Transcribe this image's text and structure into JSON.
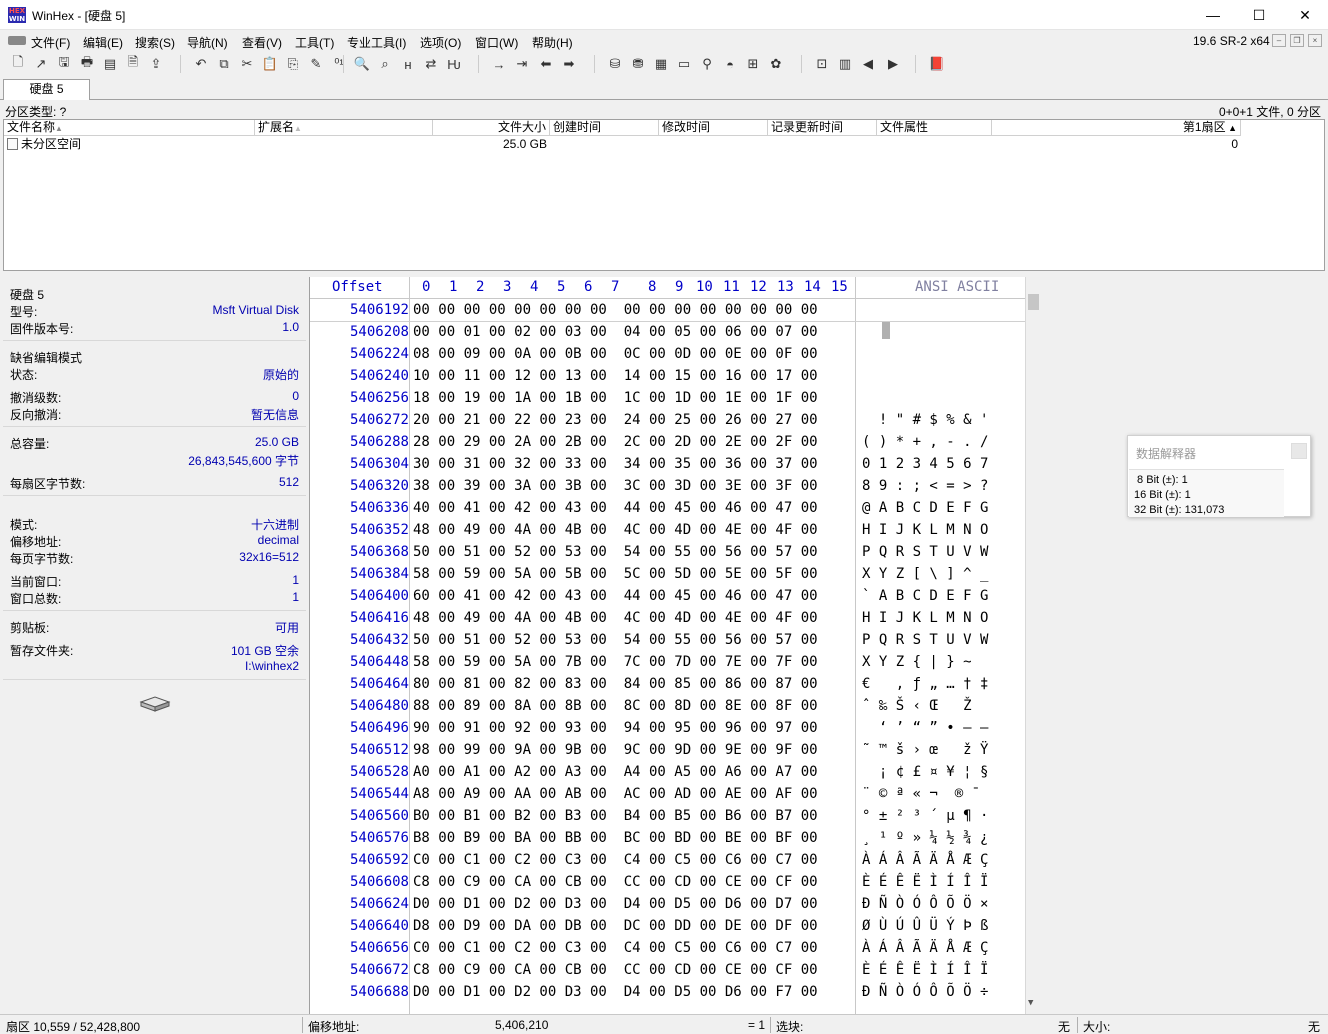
{
  "window": {
    "title": "WinHex - [硬盘 5]",
    "logo_line1": "HEX",
    "logo_line2": "WIN",
    "minimize_glyph": "—",
    "maximize_glyph": "☐",
    "close_glyph": "✕"
  },
  "menu": {
    "items": [
      "文件(F)",
      "编辑(E)",
      "搜索(S)",
      "导航(N)",
      "查看(V)",
      "工具(T)",
      "专业工具(I)",
      "选项(O)",
      "窗口(W)",
      "帮助(H)"
    ],
    "version": "19.6 SR-2 x64"
  },
  "toolbar": {
    "icons": [
      "new-file-icon",
      "open-icon",
      "save-icon",
      "print-icon",
      "properties-icon",
      "document-icon",
      "export-icon",
      "undo-icon",
      "copy-icon",
      "cut-icon",
      "paste-icon",
      "paste-special-icon",
      "write-icon",
      "binary-icon",
      "find-icon",
      "find-next-icon",
      "find-hex-icon",
      "replace-icon",
      "replace-hex-icon",
      "goto-offset-icon",
      "goto-sector-icon",
      "back-icon",
      "forward-icon",
      "disk-open-icon",
      "disk-clone-icon",
      "ram-icon",
      "calculator-icon",
      "search-disk-icon",
      "image-icon",
      "hash-icon",
      "settings-icon",
      "grid-icon",
      "table-icon",
      "prev-icon",
      "next-icon",
      "book-icon"
    ],
    "glyphs": [
      "🗋",
      "↗",
      "🖫",
      "🖶",
      "▤",
      "🗎",
      "⇪",
      "↶",
      "⧉",
      "✂",
      "📋",
      "⎘",
      "✎",
      "⁰¹",
      "🔍",
      "⌕",
      "ʜ",
      "⇄",
      "Ƕ",
      "→",
      "⇥",
      "⬅",
      "➡",
      "⛁",
      "⛃",
      "▦",
      "▭",
      "⚲",
      "◓",
      "⊞",
      "✿",
      "⊡",
      "▥",
      "◀",
      "▶",
      "📕"
    ]
  },
  "tab": {
    "label": "硬盘 5"
  },
  "partition": {
    "type_label": "分区类型: ?",
    "summary": "0+0+1 文件, 0 分区"
  },
  "file_list": {
    "columns": [
      "文件名称",
      "扩展名",
      "文件大小",
      "创建时间",
      "修改时间",
      "记录更新时间",
      "文件属性",
      "第1扇区"
    ],
    "rows": [
      {
        "name": "未分区空间",
        "ext": "",
        "size": "25.0 GB",
        "created": "",
        "modified": "",
        "record_changed": "",
        "attributes": "",
        "first_sector": "0"
      }
    ]
  },
  "info_panel": {
    "disk_name": "硬盘 5",
    "model_label": "型号:",
    "model_value": "Msft Virtual Disk",
    "firmware_label": "固件版本号:",
    "firmware_value": "1.0",
    "edit_mode_label": "缺省编辑模式",
    "state_label": "状态:",
    "state_value": "原始的",
    "undo_levels_label": "撤消级数:",
    "undo_levels_value": "0",
    "reverse_undo_label": "反向撤消:",
    "reverse_undo_value": "暂无信息",
    "capacity_label": "总容量:",
    "capacity_value": "25.0 GB",
    "capacity_bytes": "26,843,545,600 字节",
    "bytes_per_sector_label": "每扇区字节数:",
    "bytes_per_sector_value": "512",
    "mode_label": "模式:",
    "mode_value": "十六进制",
    "offset_label": "偏移地址:",
    "offset_value": "decimal",
    "bytes_per_page_label": "每页字节数:",
    "bytes_per_page_value": "32x16=512",
    "current_window_label": "当前窗口:",
    "current_window_value": "1",
    "total_windows_label": "窗口总数:",
    "total_windows_value": "1",
    "clipboard_label": "剪贴板:",
    "clipboard_value": "可用",
    "temp_folder_label": "暂存文件夹:",
    "temp_folder_free": "101 GB 空余",
    "temp_folder_path": "I:\\winhex2"
  },
  "hex_view": {
    "offset_header": "Offset",
    "column_headers": [
      "0",
      "1",
      "2",
      "3",
      "4",
      "5",
      "6",
      "7",
      "8",
      "9",
      "10",
      "11",
      "12",
      "13",
      "14",
      "15"
    ],
    "ansi_header": "ANSI ASCII",
    "rows": [
      {
        "offset": "5406192",
        "bytes": "00 00 00 00 00 00 00 00  00 00 00 00 00 00 00 00",
        "ansi": ""
      },
      {
        "offset": "5406208",
        "bytes": "00 00 01 00 02 00 03 00  04 00 05 00 06 00 07 00",
        "ansi": ""
      },
      {
        "offset": "5406224",
        "bytes": "08 00 09 00 0A 00 0B 00  0C 00 0D 00 0E 00 0F 00",
        "ansi": ""
      },
      {
        "offset": "5406240",
        "bytes": "10 00 11 00 12 00 13 00  14 00 15 00 16 00 17 00",
        "ansi": ""
      },
      {
        "offset": "5406256",
        "bytes": "18 00 19 00 1A 00 1B 00  1C 00 1D 00 1E 00 1F 00",
        "ansi": ""
      },
      {
        "offset": "5406272",
        "bytes": "20 00 21 00 22 00 23 00  24 00 25 00 26 00 27 00",
        "ansi": "  ! \" # $ % & '"
      },
      {
        "offset": "5406288",
        "bytes": "28 00 29 00 2A 00 2B 00  2C 00 2D 00 2E 00 2F 00",
        "ansi": "( ) * + , - . /"
      },
      {
        "offset": "5406304",
        "bytes": "30 00 31 00 32 00 33 00  34 00 35 00 36 00 37 00",
        "ansi": "0 1 2 3 4 5 6 7"
      },
      {
        "offset": "5406320",
        "bytes": "38 00 39 00 3A 00 3B 00  3C 00 3D 00 3E 00 3F 00",
        "ansi": "8 9 : ; < = > ?"
      },
      {
        "offset": "5406336",
        "bytes": "40 00 41 00 42 00 43 00  44 00 45 00 46 00 47 00",
        "ansi": "@ A B C D E F G"
      },
      {
        "offset": "5406352",
        "bytes": "48 00 49 00 4A 00 4B 00  4C 00 4D 00 4E 00 4F 00",
        "ansi": "H I J K L M N O"
      },
      {
        "offset": "5406368",
        "bytes": "50 00 51 00 52 00 53 00  54 00 55 00 56 00 57 00",
        "ansi": "P Q R S T U V W"
      },
      {
        "offset": "5406384",
        "bytes": "58 00 59 00 5A 00 5B 00  5C 00 5D 00 5E 00 5F 00",
        "ansi": "X Y Z [ \\ ] ^ _"
      },
      {
        "offset": "5406400",
        "bytes": "60 00 41 00 42 00 43 00  44 00 45 00 46 00 47 00",
        "ansi": "` A B C D E F G"
      },
      {
        "offset": "5406416",
        "bytes": "48 00 49 00 4A 00 4B 00  4C 00 4D 00 4E 00 4F 00",
        "ansi": "H I J K L M N O"
      },
      {
        "offset": "5406432",
        "bytes": "50 00 51 00 52 00 53 00  54 00 55 00 56 00 57 00",
        "ansi": "P Q R S T U V W"
      },
      {
        "offset": "5406448",
        "bytes": "58 00 59 00 5A 00 7B 00  7C 00 7D 00 7E 00 7F 00",
        "ansi": "X Y Z { | } ~"
      },
      {
        "offset": "5406464",
        "bytes": "80 00 81 00 82 00 83 00  84 00 85 00 86 00 87 00",
        "ansi": "€   ‚ ƒ „ … † ‡"
      },
      {
        "offset": "5406480",
        "bytes": "88 00 89 00 8A 00 8B 00  8C 00 8D 00 8E 00 8F 00",
        "ansi": "ˆ ‰ Š ‹ Œ   Ž"
      },
      {
        "offset": "5406496",
        "bytes": "90 00 91 00 92 00 93 00  94 00 95 00 96 00 97 00",
        "ansi": "  ‘ ’ “ ” • – —"
      },
      {
        "offset": "5406512",
        "bytes": "98 00 99 00 9A 00 9B 00  9C 00 9D 00 9E 00 9F 00",
        "ansi": "˜ ™ š › œ   ž Ÿ"
      },
      {
        "offset": "5406528",
        "bytes": "A0 00 A1 00 A2 00 A3 00  A4 00 A5 00 A6 00 A7 00",
        "ansi": "  ¡ ¢ £ ¤ ¥ ¦ §"
      },
      {
        "offset": "5406544",
        "bytes": "A8 00 A9 00 AA 00 AB 00  AC 00 AD 00 AE 00 AF 00",
        "ansi": "¨ © ª « ¬ ­ ® ¯"
      },
      {
        "offset": "5406560",
        "bytes": "B0 00 B1 00 B2 00 B3 00  B4 00 B5 00 B6 00 B7 00",
        "ansi": "° ± ² ³ ´ µ ¶ ·"
      },
      {
        "offset": "5406576",
        "bytes": "B8 00 B9 00 BA 00 BB 00  BC 00 BD 00 BE 00 BF 00",
        "ansi": "¸ ¹ º » ¼ ½ ¾ ¿"
      },
      {
        "offset": "5406592",
        "bytes": "C0 00 C1 00 C2 00 C3 00  C4 00 C5 00 C6 00 C7 00",
        "ansi": "À Á Â Ã Ä Å Æ Ç"
      },
      {
        "offset": "5406608",
        "bytes": "C8 00 C9 00 CA 00 CB 00  CC 00 CD 00 CE 00 CF 00",
        "ansi": "È É Ê Ë Ì Í Î Ï"
      },
      {
        "offset": "5406624",
        "bytes": "D0 00 D1 00 D2 00 D3 00  D4 00 D5 00 D6 00 D7 00",
        "ansi": "Ð Ñ Ò Ó Ô Õ Ö ×"
      },
      {
        "offset": "5406640",
        "bytes": "D8 00 D9 00 DA 00 DB 00  DC 00 DD 00 DE 00 DF 00",
        "ansi": "Ø Ù Ú Û Ü Ý Þ ß"
      },
      {
        "offset": "5406656",
        "bytes": "C0 00 C1 00 C2 00 C3 00  C4 00 C5 00 C6 00 C7 00",
        "ansi": "À Á Â Ã Ä Å Æ Ç"
      },
      {
        "offset": "5406672",
        "bytes": "C8 00 C9 00 CA 00 CB 00  CC 00 CD 00 CE 00 CF 00",
        "ansi": "È É Ê Ë Ì Í Î Ï"
      },
      {
        "offset": "5406688",
        "bytes": "D0 00 D1 00 D2 00 D3 00  D4 00 D5 00 D6 00 F7 00",
        "ansi": "Ð Ñ Ò Ó Ô Õ Ö ÷"
      }
    ]
  },
  "data_interpreter": {
    "title": "数据解释器",
    "rows": [
      " 8 Bit (±): 1",
      "16 Bit (±): 1",
      "32 Bit (±): 131,073"
    ]
  },
  "status_bar": {
    "sector": "扇区 10,559 / 52,428,800",
    "offset_label": "偏移地址:",
    "offset_value": "5,406,210",
    "equals": "= 1",
    "selection_label": "选块:",
    "selection_value": "无",
    "size_label": "大小:",
    "size_value": "无"
  },
  "colors": {
    "offset_blue": "#0000c8",
    "info_value_blue": "#0000b0",
    "ansi_header_gray": "#8080a0"
  }
}
